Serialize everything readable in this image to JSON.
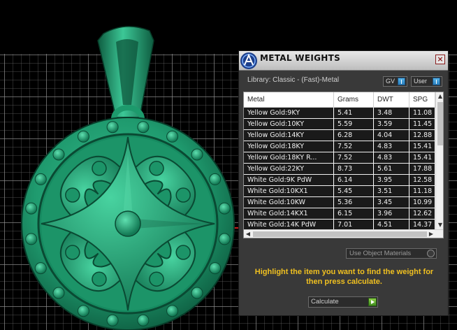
{
  "panel": {
    "title": "METAL WEIGHTS",
    "close_label": "×",
    "library_label": "Library: Classic - (Fast)-Metal",
    "gv_label": "GV",
    "user_label": "User",
    "use_object_materials_label": "Use Object Materials",
    "hint_text": "Highlight the item you want to find the weight for then press calculate.",
    "calculate_label": "Calculate"
  },
  "table": {
    "headers": [
      "Metal",
      "Grams",
      "DWT",
      "SPG"
    ],
    "rows": [
      [
        "Yellow Gold:9KY",
        "5.41",
        "3.48",
        "11.08"
      ],
      [
        "Yellow Gold:10KY",
        "5.59",
        "3.59",
        "11.45"
      ],
      [
        "Yellow Gold:14KY",
        "6.28",
        "4.04",
        "12.88"
      ],
      [
        "Yellow Gold:18KY",
        "7.52",
        "4.83",
        "15.41"
      ],
      [
        "Yellow Gold:18KY R...",
        "7.52",
        "4.83",
        "15.41"
      ],
      [
        "Yellow Gold:22KY",
        "8.73",
        "5.61",
        "17.88"
      ],
      [
        "White Gold:9K PdW",
        "6.14",
        "3.95",
        "12.58"
      ],
      [
        "White Gold:10KX1",
        "5.45",
        "3.51",
        "11.18"
      ],
      [
        "White Gold:10KW",
        "5.36",
        "3.45",
        "10.99"
      ],
      [
        "White Gold:14KX1",
        "6.15",
        "3.96",
        "12.62"
      ],
      [
        "White Gold:14K PdW",
        "7.01",
        "4.51",
        "14.37"
      ]
    ]
  },
  "colors": {
    "pendant": "#1f9a6e",
    "hint": "#f0c020",
    "panel_bg": "#393939",
    "axis_red": "#c81e1e"
  },
  "icons": {
    "app_logo": "app-logo-icon",
    "close": "close-icon",
    "toggle_knob": "toggle-knob-icon",
    "calculate_arrow": "play-arrow-icon"
  }
}
